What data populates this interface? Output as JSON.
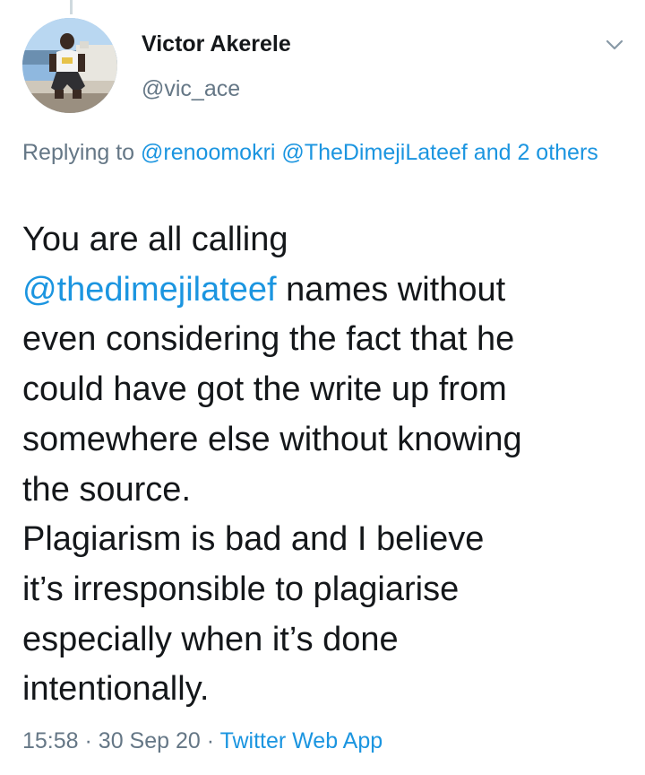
{
  "tweet": {
    "author_name": "Victor Akerele",
    "author_handle": "@vic_ace",
    "replying_prefix": "Replying to",
    "replying_users": [
      "@renoomokri",
      "@TheDimejiLateef"
    ],
    "replying_others": "and 2 others",
    "mention": "@thedimejilateef",
    "body_lines": [
      "You are all calling",
      "names without",
      "even considering the fact that he",
      "could have got the write up from",
      "somewhere else without knowing",
      "the source.",
      "Plagiarism is bad and I believe",
      "it’s irresponsible to plagiarise",
      "especially when it’s done",
      "intentionally."
    ],
    "time": "15:58",
    "separator": "·",
    "date": "30 Sep 20",
    "source": "Twitter Web App"
  },
  "icons": {
    "more": "chevron-down-icon",
    "avatar": "avatar"
  },
  "colors": {
    "text": "#14171a",
    "secondary": "#657786",
    "link": "#1b95e0"
  }
}
